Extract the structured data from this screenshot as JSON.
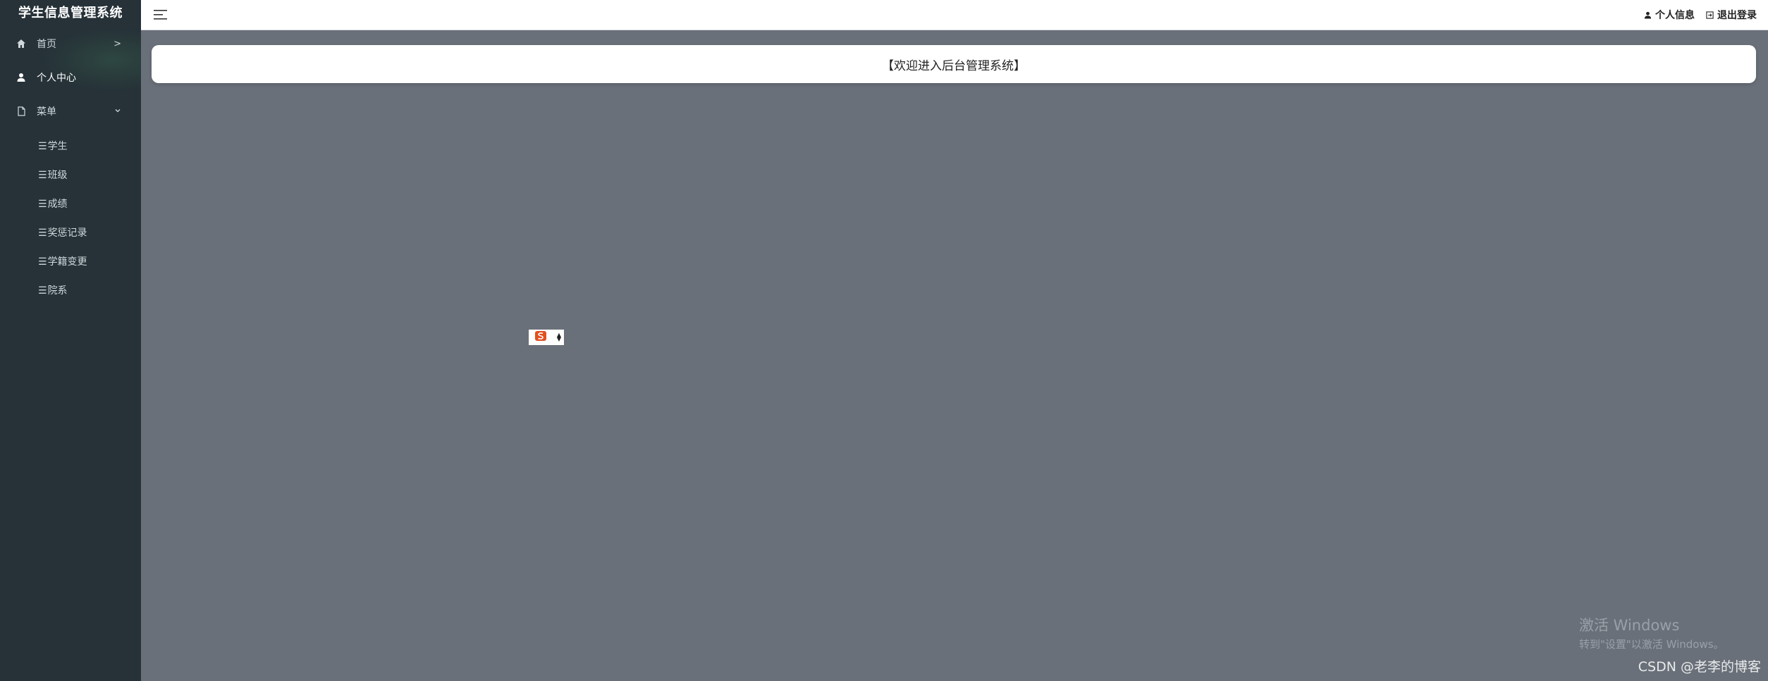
{
  "sidebar": {
    "brand": "学生信息管理系统",
    "items": [
      {
        "label": "首页",
        "arrow": ">"
      },
      {
        "label": "个人中心",
        "arrow": ""
      },
      {
        "label": "菜单",
        "arrow": "⌄"
      }
    ],
    "sub_items": [
      {
        "label": "学生"
      },
      {
        "label": "班级"
      },
      {
        "label": "成绩"
      },
      {
        "label": "奖惩记录"
      },
      {
        "label": "学籍变更"
      },
      {
        "label": "院系"
      }
    ],
    "sub_prefix": "☰"
  },
  "topbar": {
    "profile_label": "个人信息",
    "logout_label": "退出登录"
  },
  "main": {
    "welcome_text": "【欢迎进入后台管理系统】"
  },
  "watermark": {
    "windows_line1": "激活 Windows",
    "windows_line2": "转到\"设置\"以激活 Windows。",
    "csdn": "CSDN @老李的博客"
  },
  "colors": {
    "sidebar_bg": "#263238",
    "content_bg": "#6a7079",
    "topbar_bg": "#ffffff",
    "widget_icon": "#e2501f"
  }
}
